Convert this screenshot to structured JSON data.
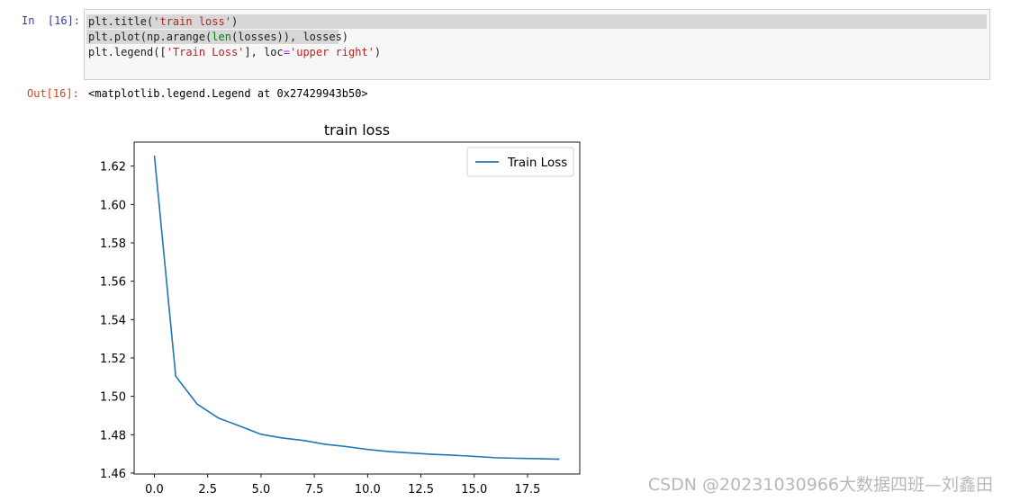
{
  "cell": {
    "in_prompt": "In  [16]:",
    "out_prompt": "Out[16]:",
    "code_lines": [
      {
        "segments": [
          {
            "t": "plt.title(",
            "c": ""
          },
          {
            "t": "'train loss'",
            "c": "str"
          },
          {
            "t": ")",
            "c": ""
          }
        ]
      },
      {
        "segments": [
          {
            "t": "plt.plot(np.arange(",
            "c": ""
          },
          {
            "t": "len",
            "c": "builtin"
          },
          {
            "t": "(losses)), losses)",
            "c": ""
          }
        ]
      },
      {
        "segments": [
          {
            "t": "plt.legend([",
            "c": ""
          },
          {
            "t": "'Train Loss'",
            "c": "str"
          },
          {
            "t": "], loc",
            "c": ""
          },
          {
            "t": "=",
            "c": "op"
          },
          {
            "t": "'upper right'",
            "c": "str"
          },
          {
            "t": ")",
            "c": ""
          }
        ]
      }
    ],
    "output_text": "<matplotlib.legend.Legend at 0x27429943b50>"
  },
  "chart_data": {
    "type": "line",
    "title": "train loss",
    "xlabel": "",
    "ylabel": "",
    "xlim": [
      -0.95,
      19.95
    ],
    "ylim": [
      1.4595,
      1.6325
    ],
    "xticks": [
      0.0,
      2.5,
      5.0,
      7.5,
      10.0,
      12.5,
      15.0,
      17.5
    ],
    "xtick_labels": [
      "0.0",
      "2.5",
      "5.0",
      "7.5",
      "10.0",
      "12.5",
      "15.0",
      "17.5"
    ],
    "yticks": [
      1.46,
      1.48,
      1.5,
      1.52,
      1.54,
      1.56,
      1.58,
      1.6,
      1.62
    ],
    "ytick_labels": [
      "1.46",
      "1.48",
      "1.50",
      "1.52",
      "1.54",
      "1.56",
      "1.58",
      "1.60",
      "1.62"
    ],
    "grid": false,
    "legend_placement": "upper right",
    "series": [
      {
        "name": "Train Loss",
        "color": "#1f77b4",
        "x": [
          0,
          1,
          2,
          3,
          4,
          5,
          6,
          7,
          8,
          9,
          10,
          11,
          12,
          13,
          14,
          15,
          16,
          17,
          18,
          19
        ],
        "y": [
          1.6255,
          1.5105,
          1.496,
          1.4887,
          1.4845,
          1.4802,
          1.4783,
          1.477,
          1.475,
          1.4738,
          1.4723,
          1.4712,
          1.4705,
          1.4698,
          1.4693,
          1.4687,
          1.468,
          1.4677,
          1.4675,
          1.4672
        ]
      }
    ]
  },
  "watermark": "CSDN @20231030966大数据四班—刘鑫田"
}
